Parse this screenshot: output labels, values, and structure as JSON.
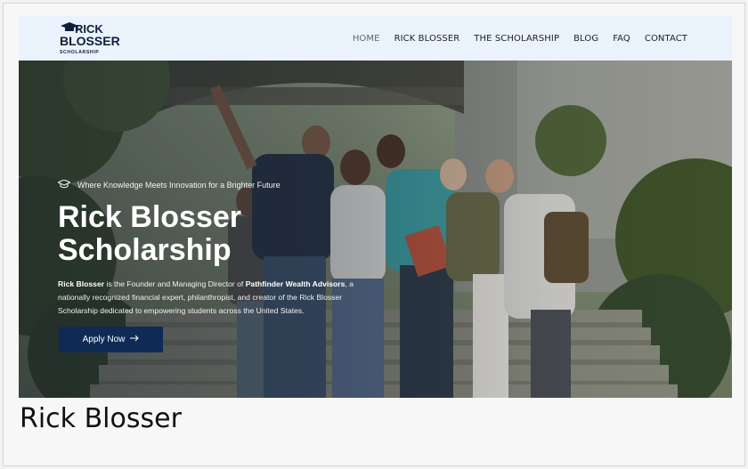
{
  "logo": {
    "line1": "RICK",
    "line2": "BLOSSER",
    "line3": "SCHOLARSHIP"
  },
  "nav": [
    {
      "label": "HOME",
      "active": true
    },
    {
      "label": "RICK BLOSSER",
      "active": false
    },
    {
      "label": "THE SCHOLARSHIP",
      "active": false
    },
    {
      "label": "BLOG",
      "active": false
    },
    {
      "label": "FAQ",
      "active": false
    },
    {
      "label": "CONTACT",
      "active": false
    }
  ],
  "hero": {
    "tagline": "Where Knowledge Meets Innovation for a Brighter Future",
    "title_line1": "Rick Blosser",
    "title_line2": "Scholarship",
    "desc": {
      "name": "Rick Blosser",
      "part1": " is the Founder and Managing Director of ",
      "company": "Pathfinder Wealth Advisors",
      "part2": ", a nationally recognized financial expert, philanthropist, and creator of the Rick Blosser Scholarship dedicated to empowering students across the United States."
    },
    "cta": "Apply Now",
    "cta_icon": "arrow-right-icon",
    "tagline_icon": "graduation-cap-icon"
  },
  "caption": "Rick Blosser",
  "colors": {
    "header_bg": "#eaf3fc",
    "cta_bg": "#0f2a55",
    "text_dark": "#222222"
  }
}
